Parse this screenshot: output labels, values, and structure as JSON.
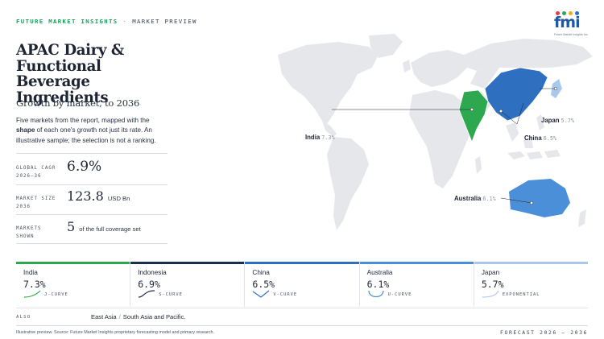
{
  "header": {
    "brand": "FUTURE MARKET INSIGHTS",
    "separator": "·",
    "section": "MARKET PREVIEW",
    "logo_text": "fmi",
    "logo_tagline": "Future Market Insights Inc."
  },
  "title": "APAC Dairy & Functional Beverage Ingredients",
  "subtitle": "Growth by market, to 2036",
  "description": {
    "part1": "Five markets from the report, mapped with the ",
    "bold": "shape",
    "part2": " of each one's growth not just its rate. An illustrative sample; the selection is not a ranking."
  },
  "stats": [
    {
      "label_line1": "GLOBAL CAGR",
      "label_line2": "2026–36",
      "value": "6.9%",
      "unit": ""
    },
    {
      "label_line1": "MARKET SIZE",
      "label_line2": "2036",
      "value": "123.8",
      "unit": "USD Bn"
    },
    {
      "label_line1": "MARKETS",
      "label_line2": "SHOWN",
      "value": "5",
      "unit": "of the full coverage set"
    }
  ],
  "map_labels": [
    {
      "name": "India",
      "value": "7.3%"
    },
    {
      "name": "Japan",
      "value": "5.7%"
    },
    {
      "name": "China",
      "value": "6.5%"
    },
    {
      "name": "Australia",
      "value": "6.1%"
    }
  ],
  "cards": [
    {
      "name": "India",
      "pct": "7.3%",
      "curve_type": "J-CURVE",
      "color": "#2ea84f"
    },
    {
      "name": "Indonesia",
      "pct": "6.9%",
      "curve_type": "S-CURVE",
      "color": "#1d2d4f"
    },
    {
      "name": "China",
      "pct": "6.5%",
      "curve_type": "V-CURVE",
      "color": "#2f6fc0"
    },
    {
      "name": "Australia",
      "pct": "6.1%",
      "curve_type": "U-CURVE",
      "color": "#4a8fd8"
    },
    {
      "name": "Japan",
      "pct": "5.7%",
      "curve_type": "EXPONENTIAL",
      "color": "#a9c8ec"
    }
  ],
  "also": {
    "label": "ALSO",
    "item1": "East Asia",
    "separator": "/",
    "item2": "South Asia and Pacific."
  },
  "footer": {
    "source": "Illustrative preview. Source: Future Market Insights proprietary forecasting model and primary research.",
    "forecast": "FORECAST 2026 – 2036"
  },
  "colors": {
    "india": "#2ea84f",
    "china": "#2f6fc0",
    "australia": "#4a8fd8",
    "japan": "#a9c8ec",
    "land": "#e5e7eb"
  }
}
